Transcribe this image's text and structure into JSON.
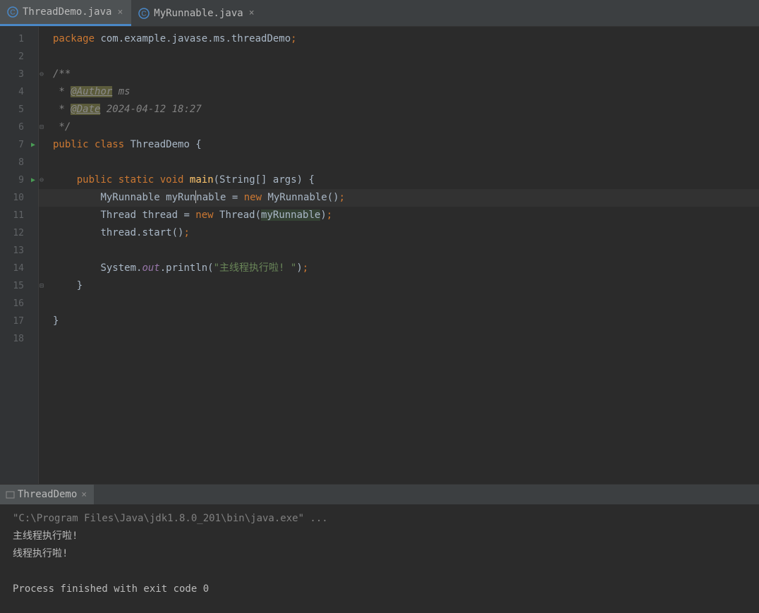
{
  "tabs": [
    {
      "name": "ThreadDemo.java",
      "active": true
    },
    {
      "name": "MyRunnable.java",
      "active": false
    }
  ],
  "lineNumbers": [
    "1",
    "2",
    "3",
    "4",
    "5",
    "6",
    "7",
    "8",
    "9",
    "10",
    "11",
    "12",
    "13",
    "14",
    "15",
    "16",
    "17",
    "18"
  ],
  "code": {
    "l1_kw": "package",
    "l1_rest": " com.example.javase.ms.threadDemo",
    "l1_semi": ";",
    "l3": "/**",
    "l4_pre": " * ",
    "l4_tag": "@Author",
    "l4_rest": " ms",
    "l5_pre": " * ",
    "l5_tag": "@Date",
    "l5_rest": " 2024-04-12 18:27",
    "l6": " */",
    "l7_pub": "public ",
    "l7_class": "class ",
    "l7_name": "ThreadDemo {",
    "l9_pub": "public ",
    "l9_static": "static ",
    "l9_void": "void ",
    "l9_main": "main",
    "l9_rest": "(String[] args) {",
    "l10_pre": "MyRunnable myRun",
    "l10_post": "nable = ",
    "l10_new": "new ",
    "l10_rest": "MyRunnable()",
    "l10_semi": ";",
    "l11_pre": "Thread thread = ",
    "l11_new": "new ",
    "l11_thread": "Thread(",
    "l11_param": "myRunnable",
    "l11_close": ")",
    "l11_semi": ";",
    "l12_pre": "thread.start()",
    "l12_semi": ";",
    "l14_sys": "System.",
    "l14_out": "out",
    "l14_print": ".println(",
    "l14_str": "\"主线程执行啦! \"",
    "l14_close": ")",
    "l14_semi": ";",
    "l15": "}",
    "l17": "}"
  },
  "console": {
    "tabLabel": "ThreadDemo",
    "cmd": "\"C:\\Program Files\\Java\\jdk1.8.0_201\\bin\\java.exe\" ...",
    "out1": "主线程执行啦!",
    "out2": "线程执行啦!",
    "exit": "Process finished with exit code 0"
  }
}
